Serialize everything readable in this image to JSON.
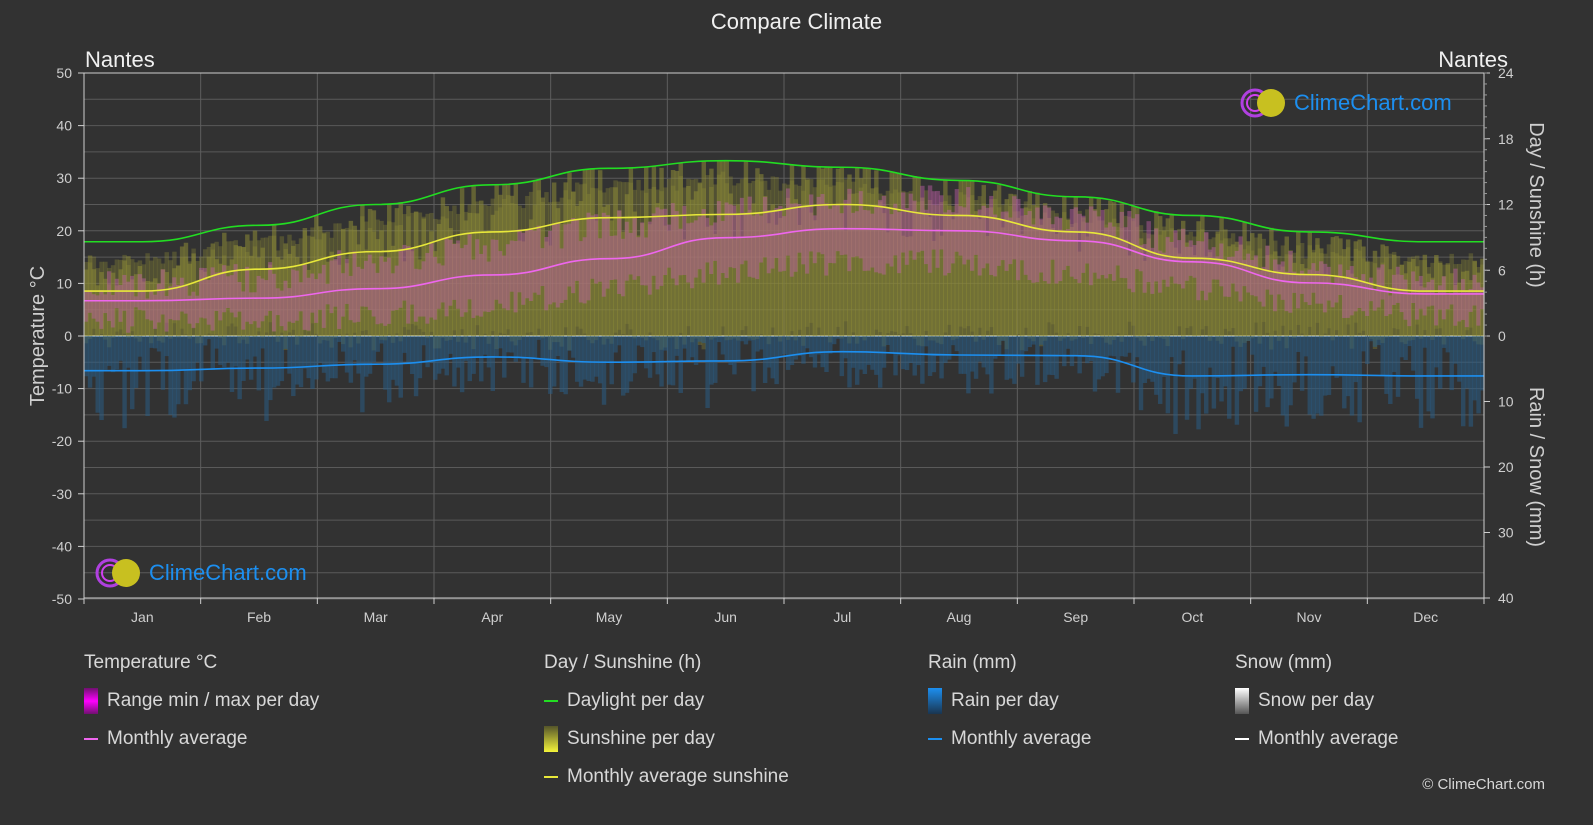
{
  "header": {
    "title": "Compare Climate",
    "city_left": "Nantes",
    "city_right": "Nantes"
  },
  "logo": {
    "text": "ClimeChart.com"
  },
  "copyright": "© ClimeChart.com",
  "colors": {
    "daylight": "#22dd22",
    "sunshine_avg": "#e8e83a",
    "temp_avg": "#ee66ee",
    "rain_avg": "#1c8ff0",
    "sunshine_fill": "#8c8a36",
    "temp_fill": "#c060a8",
    "rain_fill": "#2a5d85",
    "background": "#323232"
  },
  "legend": {
    "temperature": {
      "title": "Temperature °C",
      "items": [
        "Range min / max per day",
        "Monthly average"
      ]
    },
    "sunshine": {
      "title": "Day / Sunshine (h)",
      "items": [
        "Daylight per day",
        "Sunshine per day",
        "Monthly average sunshine"
      ]
    },
    "rain": {
      "title": "Rain (mm)",
      "items": [
        "Rain per day",
        "Monthly average"
      ]
    },
    "snow": {
      "title": "Snow (mm)",
      "items": [
        "Snow per day",
        "Monthly average"
      ]
    }
  },
  "chart_data": {
    "type": "line",
    "title": "Compare Climate",
    "categories": [
      "Jan",
      "Feb",
      "Mar",
      "Apr",
      "May",
      "Jun",
      "Jul",
      "Aug",
      "Sep",
      "Oct",
      "Nov",
      "Dec"
    ],
    "left_axis": {
      "label": "Temperature °C",
      "range": [
        -50,
        50
      ],
      "ticks": [
        50,
        40,
        30,
        20,
        10,
        0,
        -10,
        -20,
        -30,
        -40,
        -50
      ]
    },
    "right_axis_top": {
      "label": "Day / Sunshine (h)",
      "range": [
        0,
        24
      ],
      "ticks": [
        24,
        18,
        12,
        6,
        0
      ]
    },
    "right_axis_bottom": {
      "label": "Rain / Snow (mm)",
      "range": [
        0,
        40
      ],
      "ticks": [
        0,
        10,
        20,
        30,
        40
      ]
    },
    "grid": true,
    "series": [
      {
        "name": "Daylight per day",
        "axis": "hours",
        "values": [
          8.6,
          10.1,
          12.0,
          13.8,
          15.3,
          16.0,
          15.4,
          14.2,
          12.7,
          11.0,
          9.5,
          8.6
        ]
      },
      {
        "name": "Monthly average sunshine",
        "axis": "hours",
        "values": [
          4.1,
          6.1,
          7.7,
          9.5,
          10.8,
          11.1,
          12.0,
          11.0,
          9.5,
          7.1,
          5.6,
          4.1
        ]
      },
      {
        "name": "Temperature monthly average",
        "axis": "temperature",
        "values": [
          6.7,
          7.2,
          9.0,
          11.6,
          14.7,
          18.7,
          20.4,
          20.0,
          18.1,
          14.1,
          10.1,
          8.0
        ]
      },
      {
        "name": "Rain monthly average",
        "axis": "rain",
        "values": [
          5.3,
          4.9,
          4.3,
          3.2,
          4.0,
          3.8,
          2.4,
          2.9,
          3.0,
          6.1,
          5.9,
          6.1
        ]
      },
      {
        "name": "Temperature daily max (approx)",
        "axis": "temperature",
        "values": [
          10,
          11,
          14,
          17,
          21,
          24,
          26,
          26,
          23,
          18,
          13,
          10
        ]
      },
      {
        "name": "Temperature daily min (approx)",
        "axis": "temperature",
        "values": [
          3,
          3,
          4,
          6,
          9,
          12,
          14,
          14,
          12,
          9,
          6,
          4
        ]
      }
    ]
  }
}
